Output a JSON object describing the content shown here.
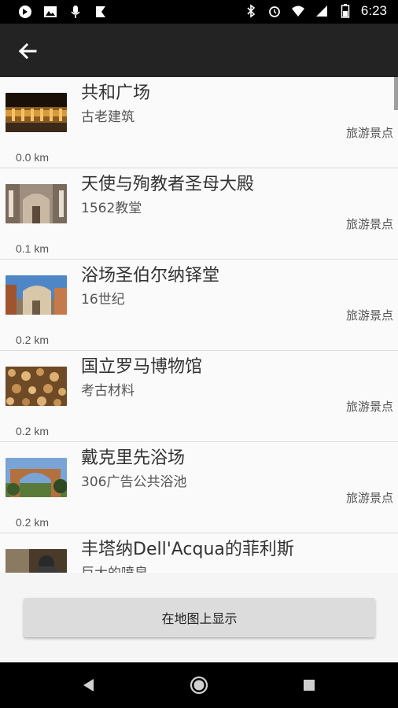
{
  "status_bar": {
    "time": "6:23",
    "left_icons": [
      "firefox-icon",
      "image-icon",
      "mic-icon",
      "flag-icon"
    ],
    "right_icons": [
      "bluetooth-icon",
      "alarm-icon",
      "wifi-icon",
      "signal-icon",
      "battery-icon"
    ]
  },
  "app_bar": {
    "back_icon": "arrow-back-icon"
  },
  "places": [
    {
      "name": "共和广场",
      "subtitle": "古老建筑",
      "category": "旅游景点",
      "distance": "0.0 km"
    },
    {
      "name": "天使与殉教者圣母大殿",
      "subtitle": "1562教堂",
      "category": "旅游景点",
      "distance": "0.1 km"
    },
    {
      "name": "浴场圣伯尔纳铎堂",
      "subtitle": "16世纪",
      "category": "旅游景点",
      "distance": "0.2 km"
    },
    {
      "name": "国立罗马博物馆",
      "subtitle": "考古材料",
      "category": "旅游景点",
      "distance": "0.2 km"
    },
    {
      "name": "戴克里先浴场",
      "subtitle": "306广告公共浴池",
      "category": "旅游景点",
      "distance": "0.2 km"
    },
    {
      "name": "丰塔纳Dell'Acqua的菲利斯",
      "subtitle": "巨大的喷泉",
      "category": "",
      "distance": ""
    }
  ],
  "footer": {
    "map_button_label": "在地图上显示"
  },
  "nav_bar": {
    "icons": [
      "back-triangle-icon",
      "home-circle-icon",
      "recents-square-icon"
    ]
  }
}
